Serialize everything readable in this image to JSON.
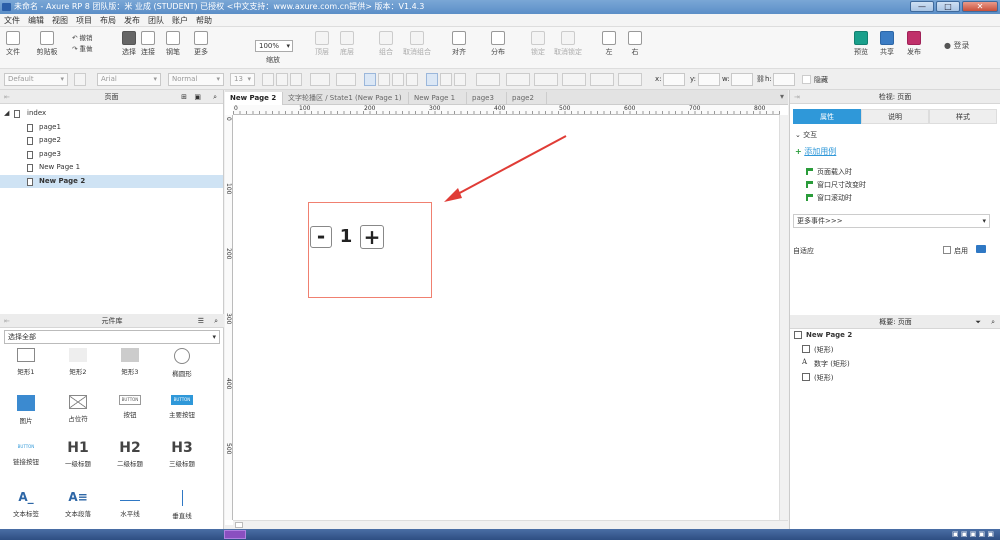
{
  "titlebar": {
    "text": "未命名 - Axure RP 8 团队版：米 业成 (STUDENT) 已授权    <中文支持：www.axure.com.cn提供> 版本：V1.4.3",
    "minimize": "—",
    "maximize": "□",
    "close": "✕"
  },
  "menubar": [
    "文件",
    "编辑",
    "视图",
    "项目",
    "布局",
    "发布",
    "团队",
    "账户",
    "帮助"
  ],
  "toolbar": {
    "file": "文件",
    "clipboard": "剪贴板",
    "cut": "",
    "undo": "撤销",
    "redo": "重做",
    "select": "选择",
    "connect": "连接",
    "pen": "钢笔",
    "more": "更多",
    "zoom": "100%",
    "zoom_label": "缩放",
    "top": "顶层",
    "bottom": "底层",
    "group": "组合",
    "ungroup": "取消组合",
    "align": "对齐",
    "distribute": "分布",
    "lock": "锁定",
    "unlock": "取消锁定",
    "left": "左",
    "right": "右",
    "preview": "预览",
    "share": "共享",
    "publish": "发布",
    "login": "登录"
  },
  "stylebar": {
    "style": "Default",
    "font": "Arial",
    "weight": "Normal",
    "size": "13",
    "x": "x:",
    "y": "y:",
    "w": "w:",
    "h": "h:",
    "hidden": "隐藏"
  },
  "pages_panel": {
    "title": "页面",
    "root": "index",
    "items": [
      "page1",
      "page2",
      "page3",
      "New Page 1",
      "New Page 2"
    ],
    "selected": "New Page 2"
  },
  "library_panel": {
    "title": "元件库",
    "select_all": "选择全部",
    "items": [
      "矩形1",
      "矩形2",
      "矩形3",
      "椭圆形",
      "图片",
      "占位符",
      "按钮",
      "主要按钮",
      "链接按钮",
      "一级标题",
      "二级标题",
      "三级标题",
      "文本标签",
      "文本段落",
      "水平线",
      "垂直线"
    ],
    "button_text": "BUTTON",
    "h1": "H1",
    "h2": "H2",
    "h3": "H3"
  },
  "tabs": [
    "New Page 2",
    "文字轮播区 / State1 (New Page 1)",
    "New Page 1",
    "page3",
    "page2"
  ],
  "ruler": {
    "top": [
      "0",
      "100",
      "200",
      "300",
      "400",
      "500",
      "600",
      "700",
      "800"
    ],
    "left": [
      "0",
      "100",
      "200",
      "300",
      "400",
      "500"
    ]
  },
  "widget": {
    "minus": "-",
    "value": "1",
    "plus": "+"
  },
  "inspector": {
    "title": "检视: 页面",
    "tabs": [
      "属性",
      "说明",
      "样式"
    ],
    "section": "交互",
    "add_case": "添加用例",
    "events": [
      "页面载入时",
      "窗口尺寸改变时",
      "窗口滚动时"
    ],
    "more_events": "更多事件>>>",
    "adaptive": "自适应",
    "enable": "启用"
  },
  "outline": {
    "title": "概要: 页面",
    "page": "New Page 2",
    "items": [
      "(矩形)",
      "数字 (矩形)",
      "(矩形)"
    ]
  },
  "colors": {
    "accent": "#2f98d9",
    "arrow": "#e03c36",
    "selection": "#f08070"
  }
}
